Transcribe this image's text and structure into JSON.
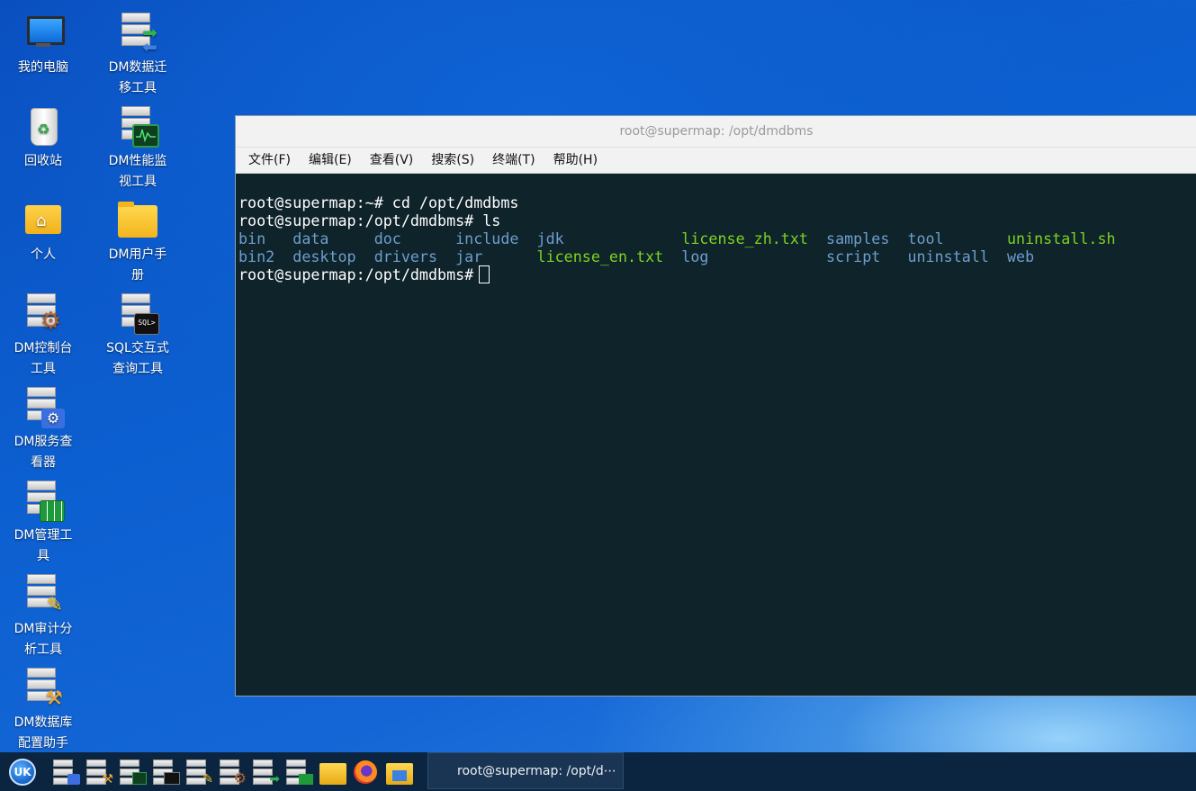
{
  "desktop": {
    "icons": [
      {
        "label": "我的电脑",
        "icon": "computer-icon"
      },
      {
        "label": "DM数据迁\n移工具",
        "icon": "dm-migration-icon"
      },
      {
        "label": "回收站",
        "icon": "recycle-bin-icon"
      },
      {
        "label": "DM性能监\n视工具",
        "icon": "dm-monitor-icon"
      },
      {
        "label": "个人",
        "icon": "home-folder-icon"
      },
      {
        "label": "DM用户手\n册",
        "icon": "folder-icon"
      },
      {
        "label": "DM控制台\n工具",
        "icon": "dm-console-icon"
      },
      {
        "label": "SQL交互式\n查询工具",
        "icon": "sql-query-icon"
      },
      {
        "label": "DM服务查\n看器",
        "icon": "dm-service-icon"
      },
      {
        "label": "DM管理工\n具",
        "icon": "dm-manager-icon"
      },
      {
        "label": "DM审计分\n析工具",
        "icon": "dm-audit-icon"
      },
      {
        "label": "DM数据库\n配置助手",
        "icon": "dm-config-icon"
      }
    ]
  },
  "terminal": {
    "title": "root@supermap: /opt/dmdbms",
    "menu": [
      "文件(F)",
      "编辑(E)",
      "查看(V)",
      "搜索(S)",
      "终端(T)",
      "帮助(H)"
    ],
    "lines": [
      "root@supermap:~# cd /opt/dmdbms",
      "root@supermap:/opt/dmdbms# ls"
    ],
    "ls_row1": [
      "bin",
      "data",
      "doc",
      "include",
      "jdk",
      "license_zh.txt",
      "samples",
      "tool",
      "uninstall.sh"
    ],
    "ls_row2": [
      "bin2",
      "desktop",
      "drivers",
      "jar",
      "license_en.txt",
      "log",
      "script",
      "uninstall",
      "web"
    ],
    "prompt": "root@supermap:/opt/dmdbms#",
    "colors": {
      "dir": "#6e9ecf",
      "exe": "#7ed321",
      "bg": "#0f232a"
    }
  },
  "taskbar": {
    "start_label": "UK",
    "task_label": "root@supermap: /opt/d⋯"
  }
}
